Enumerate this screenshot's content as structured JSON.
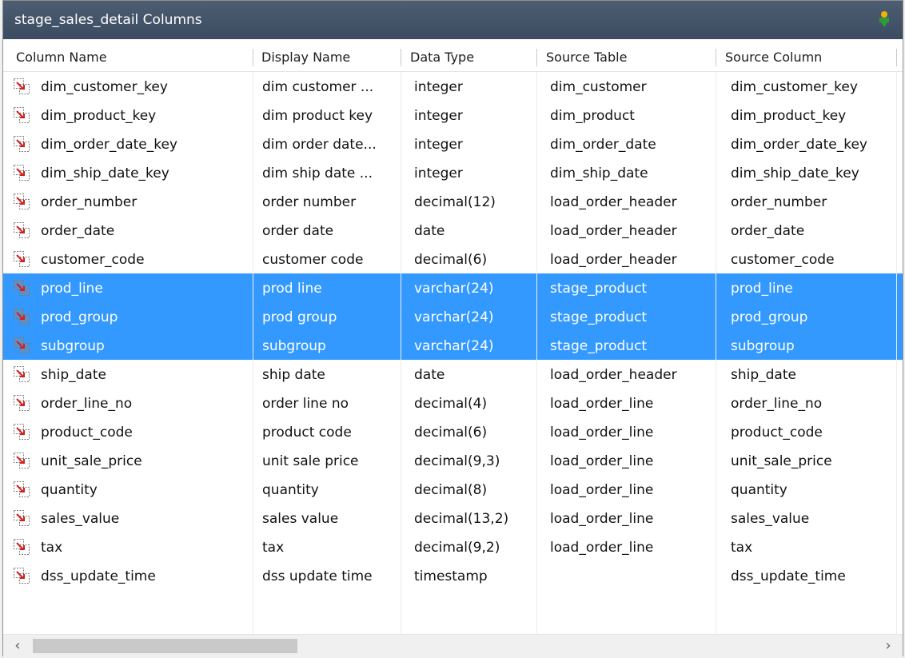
{
  "window": {
    "title": "stage_sales_detail Columns",
    "pin_icon": "pin-icon"
  },
  "columns": [
    {
      "label": "Column Name"
    },
    {
      "label": "Display Name"
    },
    {
      "label": "Data Type"
    },
    {
      "label": "Source Table"
    },
    {
      "label": "Source Column"
    }
  ],
  "rows": [
    {
      "name": "dim_customer_key",
      "display": "dim customer ...",
      "type": "integer",
      "source_table": "dim_customer",
      "source_column": "dim_customer_key",
      "selected": false
    },
    {
      "name": "dim_product_key",
      "display": "dim product key",
      "type": "integer",
      "source_table": "dim_product",
      "source_column": "dim_product_key",
      "selected": false
    },
    {
      "name": "dim_order_date_key",
      "display": "dim order date...",
      "type": "integer",
      "source_table": "dim_order_date",
      "source_column": "dim_order_date_key",
      "selected": false
    },
    {
      "name": "dim_ship_date_key",
      "display": "dim ship date ...",
      "type": "integer",
      "source_table": "dim_ship_date",
      "source_column": "dim_ship_date_key",
      "selected": false
    },
    {
      "name": "order_number",
      "display": "order number",
      "type": "decimal(12)",
      "source_table": "load_order_header",
      "source_column": "order_number",
      "selected": false
    },
    {
      "name": "order_date",
      "display": "order date",
      "type": "date",
      "source_table": "load_order_header",
      "source_column": "order_date",
      "selected": false
    },
    {
      "name": "customer_code",
      "display": "customer code",
      "type": "decimal(6)",
      "source_table": "load_order_header",
      "source_column": "customer_code",
      "selected": false
    },
    {
      "name": "prod_line",
      "display": "prod line",
      "type": "varchar(24)",
      "source_table": "stage_product",
      "source_column": "prod_line",
      "selected": true
    },
    {
      "name": "prod_group",
      "display": "prod group",
      "type": "varchar(24)",
      "source_table": "stage_product",
      "source_column": "prod_group",
      "selected": true
    },
    {
      "name": "subgroup",
      "display": "subgroup",
      "type": "varchar(24)",
      "source_table": "stage_product",
      "source_column": "subgroup",
      "selected": true
    },
    {
      "name": "ship_date",
      "display": "ship date",
      "type": "date",
      "source_table": "load_order_header",
      "source_column": "ship_date",
      "selected": false
    },
    {
      "name": "order_line_no",
      "display": "order line no",
      "type": "decimal(4)",
      "source_table": "load_order_line",
      "source_column": "order_line_no",
      "selected": false
    },
    {
      "name": "product_code",
      "display": "product code",
      "type": "decimal(6)",
      "source_table": "load_order_line",
      "source_column": "product_code",
      "selected": false
    },
    {
      "name": "unit_sale_price",
      "display": "unit sale price",
      "type": "decimal(9,3)",
      "source_table": "load_order_line",
      "source_column": "unit_sale_price",
      "selected": false
    },
    {
      "name": "quantity",
      "display": "quantity",
      "type": "decimal(8)",
      "source_table": "load_order_line",
      "source_column": "quantity",
      "selected": false
    },
    {
      "name": "sales_value",
      "display": "sales value",
      "type": "decimal(13,2)",
      "source_table": "load_order_line",
      "source_column": "sales_value",
      "selected": false
    },
    {
      "name": "tax",
      "display": "tax",
      "type": "decimal(9,2)",
      "source_table": "load_order_line",
      "source_column": "tax",
      "selected": false
    },
    {
      "name": "dss_update_time",
      "display": "dss update time",
      "type": "timestamp",
      "source_table": "",
      "source_column": "dss_update_time",
      "selected": false
    }
  ],
  "scrollbar": {
    "left_arrow": "‹",
    "right_arrow": "›",
    "position": 0.0
  },
  "colors": {
    "selection": "#3399ff",
    "titlebar": "#3f4f64"
  },
  "icons": {
    "row_icon": "column-mapping-icon"
  }
}
